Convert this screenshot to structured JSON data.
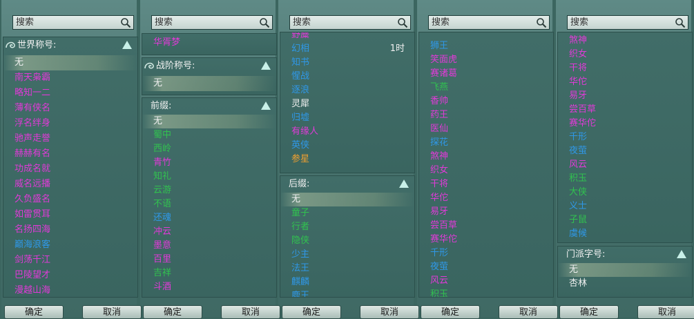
{
  "search_placeholder": "搜索",
  "buttons": {
    "ok": "确定",
    "cancel": "取消"
  },
  "col1": {
    "header": "世界称号:",
    "items": [
      {
        "t": "无",
        "c": "w",
        "sel": true
      },
      {
        "t": "南天枭霸",
        "c": "m"
      },
      {
        "t": "略知一二",
        "c": "m"
      },
      {
        "t": "薄有侠名",
        "c": "m"
      },
      {
        "t": "浮名绊身",
        "c": "m"
      },
      {
        "t": "驰声走誉",
        "c": "m"
      },
      {
        "t": "赫赫有名",
        "c": "m"
      },
      {
        "t": "功成名就",
        "c": "m"
      },
      {
        "t": "威名远播",
        "c": "m"
      },
      {
        "t": "久负盛名",
        "c": "m"
      },
      {
        "t": "如雷贯耳",
        "c": "m"
      },
      {
        "t": "名扬四海",
        "c": "m"
      },
      {
        "t": "巅海浪客",
        "c": "b"
      },
      {
        "t": "剑荡千江",
        "c": "m"
      },
      {
        "t": "巴陵望才",
        "c": "m"
      },
      {
        "t": "漫越山海",
        "c": "m"
      }
    ]
  },
  "col2": {
    "top_items": [
      {
        "t": "华胥梦",
        "c": "m"
      }
    ],
    "rank_header": "战阶称号:",
    "rank_items": [
      {
        "t": "无",
        "c": "w",
        "sel": true
      }
    ],
    "prefix_header": "前缀:",
    "prefix_items": [
      {
        "t": "无",
        "c": "w",
        "sel": true
      },
      {
        "t": "蜀中",
        "c": "g"
      },
      {
        "t": "西岭",
        "c": "g"
      },
      {
        "t": "青竹",
        "c": "m"
      },
      {
        "t": "知礼",
        "c": "g"
      },
      {
        "t": "云游",
        "c": "g"
      },
      {
        "t": "不语",
        "c": "g"
      },
      {
        "t": "还魂",
        "c": "b"
      },
      {
        "t": "冲云",
        "c": "m"
      },
      {
        "t": "墨意",
        "c": "m"
      },
      {
        "t": "百里",
        "c": "m"
      },
      {
        "t": "吉祥",
        "c": "g"
      },
      {
        "t": "斗酒",
        "c": "m"
      }
    ]
  },
  "col3": {
    "top_items": [
      {
        "t": "野麋",
        "c": "m"
      },
      {
        "t": "幻相",
        "c": "b",
        "extra": "1时"
      },
      {
        "t": "知书",
        "c": "b"
      },
      {
        "t": "惺战",
        "c": "b"
      },
      {
        "t": "逐浪",
        "c": "b"
      },
      {
        "t": "灵犀",
        "c": "w"
      },
      {
        "t": "归墟",
        "c": "b"
      },
      {
        "t": "有缘人",
        "c": "m"
      },
      {
        "t": "英侠",
        "c": "b"
      },
      {
        "t": "参星",
        "c": "o"
      }
    ],
    "suffix_header": "后缀:",
    "suffix_items": [
      {
        "t": "无",
        "c": "w",
        "sel": true
      },
      {
        "t": "童子",
        "c": "g"
      },
      {
        "t": "行者",
        "c": "g"
      },
      {
        "t": "隐侠",
        "c": "g"
      },
      {
        "t": "少主",
        "c": "b"
      },
      {
        "t": "法王",
        "c": "b"
      },
      {
        "t": "麒麟",
        "c": "b"
      },
      {
        "t": "鹿王",
        "c": "b"
      }
    ]
  },
  "col4": {
    "items": [
      {
        "t": "狮王",
        "c": "b"
      },
      {
        "t": "笑面虎",
        "c": "m"
      },
      {
        "t": "赛诸葛",
        "c": "m"
      },
      {
        "t": "飞燕",
        "c": "g"
      },
      {
        "t": "香帅",
        "c": "m"
      },
      {
        "t": "药王",
        "c": "m"
      },
      {
        "t": "医仙",
        "c": "m"
      },
      {
        "t": "探花",
        "c": "b"
      },
      {
        "t": "煞神",
        "c": "m"
      },
      {
        "t": "织女",
        "c": "m"
      },
      {
        "t": "干将",
        "c": "m"
      },
      {
        "t": "华佗",
        "c": "m"
      },
      {
        "t": "易牙",
        "c": "m"
      },
      {
        "t": "尝百草",
        "c": "m"
      },
      {
        "t": "赛华佗",
        "c": "m"
      },
      {
        "t": "千形",
        "c": "b"
      },
      {
        "t": "夜萤",
        "c": "b"
      },
      {
        "t": "风云",
        "c": "m"
      },
      {
        "t": "积玉",
        "c": "g"
      }
    ]
  },
  "col5": {
    "items": [
      {
        "t": "煞神",
        "c": "m"
      },
      {
        "t": "织女",
        "c": "m"
      },
      {
        "t": "干将",
        "c": "m"
      },
      {
        "t": "华佗",
        "c": "m"
      },
      {
        "t": "易牙",
        "c": "m"
      },
      {
        "t": "尝百草",
        "c": "m"
      },
      {
        "t": "赛华佗",
        "c": "m"
      },
      {
        "t": "千形",
        "c": "b"
      },
      {
        "t": "夜萤",
        "c": "b"
      },
      {
        "t": "风云",
        "c": "m"
      },
      {
        "t": "积玉",
        "c": "g"
      },
      {
        "t": "大侠",
        "c": "g"
      },
      {
        "t": "义士",
        "c": "b"
      },
      {
        "t": "子鼠",
        "c": "g"
      },
      {
        "t": "虞候",
        "c": "b"
      }
    ],
    "sect_header": "门派字号:",
    "sect_items": [
      {
        "t": "无",
        "c": "w",
        "sel": true
      },
      {
        "t": "杏林",
        "c": "w"
      }
    ]
  },
  "colors": {
    "magenta": "#e13ad8",
    "blue": "#2f98e8",
    "green": "#31c24f",
    "orange": "#f0a030"
  }
}
